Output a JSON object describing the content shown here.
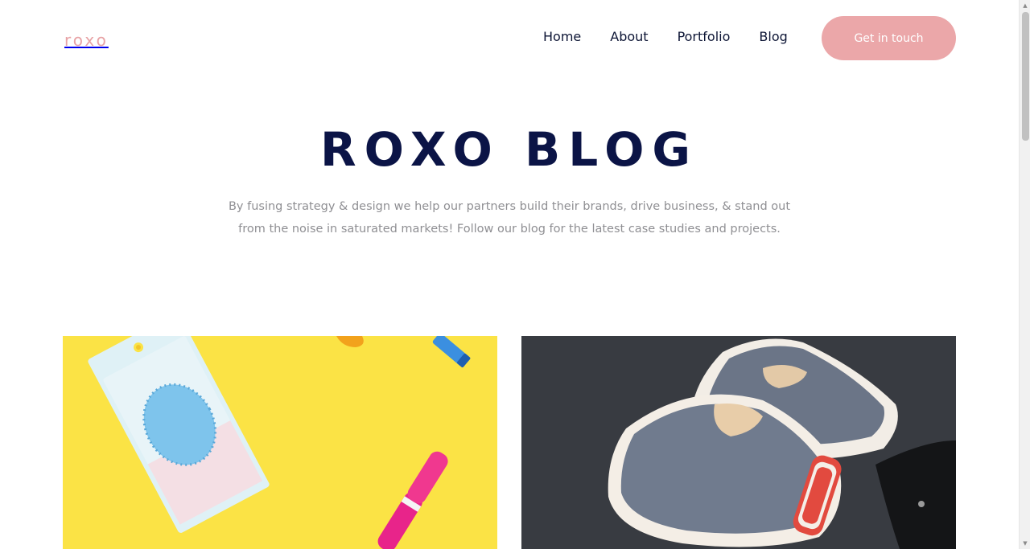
{
  "header": {
    "logo_text": "roxo",
    "nav": [
      "Home",
      "About",
      "Portfolio",
      "Blog"
    ],
    "cta_label": "Get in touch"
  },
  "hero": {
    "title": "ROXO BLOG",
    "subtitle": "By fusing strategy & design we help our partners build their brands, drive business, & stand out from the noise in saturated markets! Follow our blog for the latest case studies and projects."
  },
  "cards": [
    {
      "image": "yellow-flatlay-sponge-mascara-photo"
    },
    {
      "image": "grey-slip-on-sneakers-photo"
    }
  ],
  "colors": {
    "accent": "#eba7a9",
    "title": "#0b1446",
    "nav_text": "#0d1535",
    "body_text": "#8f8f93"
  }
}
